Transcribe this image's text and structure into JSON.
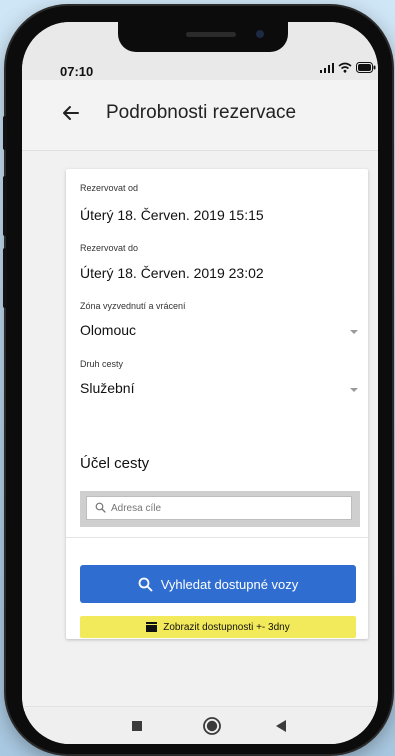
{
  "status_bar": {
    "time": "07:10",
    "icons": [
      "signal-icon",
      "wifi-icon",
      "battery-icon"
    ]
  },
  "header": {
    "back_icon": "arrow-left-icon",
    "title": "Podrobnosti rezervace"
  },
  "form": {
    "from_label": "Rezervovat od",
    "from_value": "Úterý 18. Červen. 2019 15:15",
    "to_label": "Rezervovat do",
    "to_value": "Úterý 18. Červen. 2019 23:02",
    "zone_label": "Zóna vyzvednutí a vrácení",
    "zone_value": "Olomouc",
    "trip_type_label": "Druh cesty",
    "trip_type_value": "Služební",
    "purpose_title": "Účel cesty",
    "destination_placeholder": "Adresa cíle"
  },
  "actions": {
    "search_label": "Vyhledat dostupné vozy",
    "availability_label": "Zobrazit dostupnosti +- 3dny"
  },
  "nav": {
    "items": [
      "recent-apps-icon",
      "home-icon",
      "back-icon"
    ]
  },
  "colors": {
    "primary": "#2f6ed0",
    "highlight": "#f2ea5a"
  }
}
